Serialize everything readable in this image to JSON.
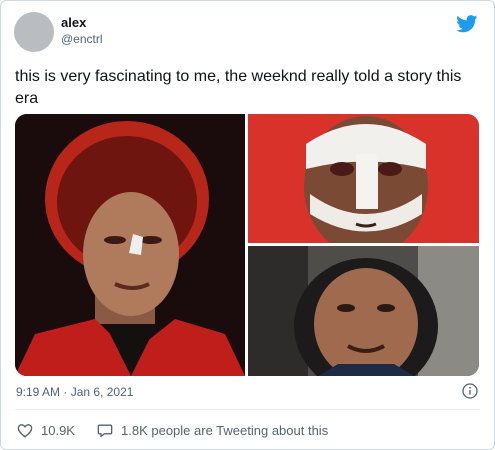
{
  "tweet": {
    "display_name": "alex",
    "handle": "@enctrl",
    "text": "this is very fascinating to me, the weeknd really told a story this era",
    "timestamp": "9:19 AM · Jan 6, 2021",
    "like_count": "10.9K",
    "reply_text": "1.8K people are Tweeting about this"
  },
  "icons": {
    "brand": "twitter-bird-icon",
    "info": "info-icon",
    "like": "heart-icon",
    "reply": "speech-bubble-icon"
  },
  "colors": {
    "brand": "#1d9bf0",
    "text": "#0f1419",
    "muted": "#536471",
    "border": "#cfd9de"
  }
}
